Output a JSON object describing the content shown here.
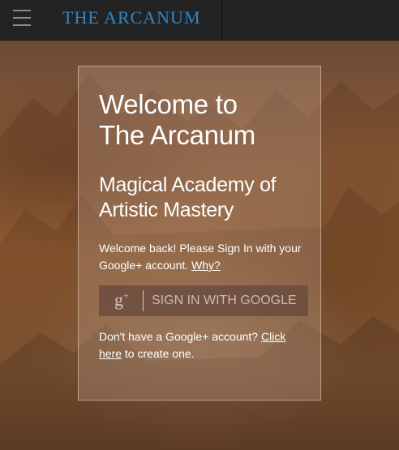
{
  "header": {
    "menu_icon": "hamburger-menu-icon",
    "logo_text": "THE ARCANUM",
    "logo_color": "#2f86c6"
  },
  "card": {
    "welcome_line1": "Welcome to",
    "welcome_line2": "The Arcanum",
    "subtitle_line1": "Magical Academy of",
    "subtitle_line2": "Artistic Mastery",
    "signin_prompt": "Welcome back! Please Sign In with your Google+ account.",
    "why_link": "Why?",
    "google_icon": "google-plus-icon",
    "google_button_label": "SIGN IN WITH GOOGLE",
    "no_account_text": "Don't have a Google+ account?",
    "click_here_link_part1": "Click",
    "click_here_link_part2": "here",
    "create_suffix": "to create one."
  },
  "colors": {
    "topbar": "#232323",
    "card_bg": "rgba(190,160,140,0.32)",
    "button_bg": "rgba(105,75,60,0.82)"
  }
}
